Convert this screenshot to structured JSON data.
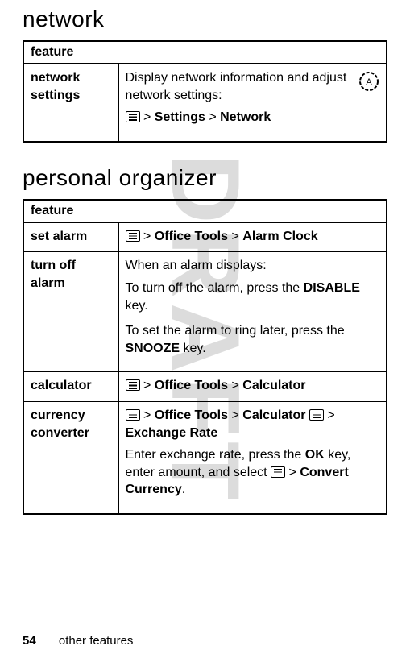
{
  "watermark": "DRAFT",
  "sections": {
    "network": {
      "heading": "network",
      "header": "feature",
      "rows": {
        "network_settings": {
          "label": "network settings",
          "desc": "Display network information and adjust network settings:",
          "path_settings": "Settings",
          "path_network": "Network",
          "gt": ">"
        }
      }
    },
    "organizer": {
      "heading": "personal organizer",
      "header": "feature",
      "rows": {
        "set_alarm": {
          "label": "set alarm",
          "gt1": ">",
          "p1": "Office Tools",
          "gt2": ">",
          "p2": "Alarm Clock"
        },
        "turn_off_alarm": {
          "label": "turn off alarm",
          "l1": "When an alarm displays:",
          "l2a": "To turn off the alarm, press the ",
          "l2b": "DISABLE",
          "l2c": " key.",
          "l3a": "To set the alarm to ring later, press the ",
          "l3b": "SNOOZE",
          "l3c": " key."
        },
        "calculator": {
          "label": "calculator",
          "gt1": ">",
          "p1": "Office Tools",
          "gt2": ">",
          "p2": "Calculator"
        },
        "currency": {
          "label": "currency converter",
          "gt1": ">",
          "p1": "Office Tools",
          "gt2": ">",
          "p2": "Calculator",
          "gt3": ">",
          "p3": "Exchange Rate",
          "d1": "Enter exchange rate, press the ",
          "d2": "OK",
          "d3": " key, enter amount, and select ",
          "gt4": ">",
          "d4": "Convert Currency",
          "d5": "."
        }
      }
    }
  },
  "footer": {
    "page": "54",
    "title": "other features"
  }
}
